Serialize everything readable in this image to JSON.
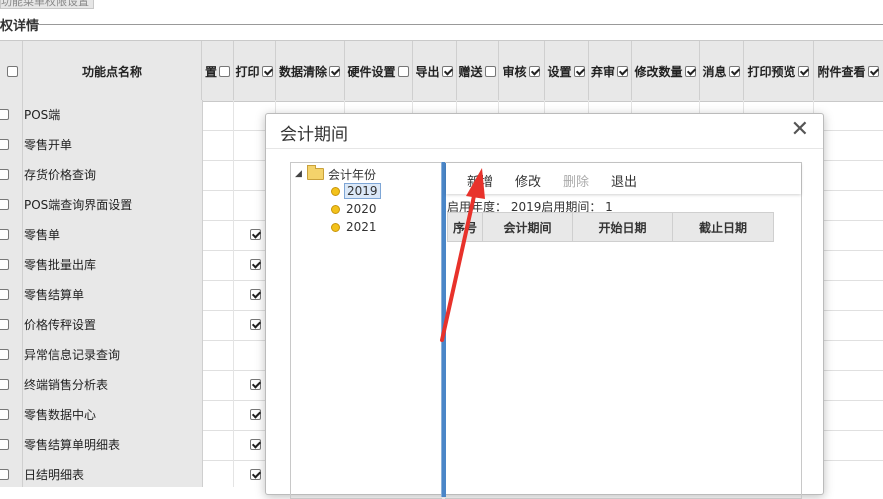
{
  "top_tab": "功能菜单权限设置",
  "section_title": "权详情",
  "grid": {
    "name_header": "功能点名称",
    "columns": [
      {
        "label": "置",
        "checked": false
      },
      {
        "label": "打印",
        "checked": true
      },
      {
        "label": "数据清除",
        "checked": true
      },
      {
        "label": "硬件设置",
        "checked": false
      },
      {
        "label": "导出",
        "checked": true
      },
      {
        "label": "赠送",
        "checked": false
      },
      {
        "label": "审核",
        "checked": true
      },
      {
        "label": "设置",
        "checked": true
      },
      {
        "label": "弃审",
        "checked": true
      },
      {
        "label": "修改数量",
        "checked": true
      },
      {
        "label": "消息",
        "checked": true
      },
      {
        "label": "打印预览",
        "checked": true
      },
      {
        "label": "附件查看",
        "checked": true
      }
    ],
    "rows": [
      {
        "name": "POS端",
        "print_checked": false
      },
      {
        "name": "零售开单",
        "print_checked": false
      },
      {
        "name": "存货价格查询",
        "print_checked": false
      },
      {
        "name": "POS端查询界面设置",
        "print_checked": false
      },
      {
        "name": "零售单",
        "print_checked": true
      },
      {
        "name": "零售批量出库",
        "print_checked": true
      },
      {
        "name": "零售结算单",
        "print_checked": true
      },
      {
        "name": "价格传秤设置",
        "print_checked": true
      },
      {
        "name": "异常信息记录查询",
        "print_checked": false
      },
      {
        "name": "终端销售分析表",
        "print_checked": true
      },
      {
        "name": "零售数据中心",
        "print_checked": true
      },
      {
        "name": "零售结算单明细表",
        "print_checked": true
      },
      {
        "name": "日结明细表",
        "print_checked": true
      }
    ]
  },
  "modal": {
    "title": "会计期间",
    "close_symbol": "✕",
    "tree": {
      "root_label": "会计年份",
      "years": [
        "2019",
        "2020",
        "2021"
      ],
      "selected": "2019"
    },
    "toolbar": {
      "add_label": "新增",
      "edit_label": "修改",
      "delete_label": "删除",
      "exit_label": "退出"
    },
    "info_text": "启用年度： 2019启用期间： 1",
    "table_headers": [
      "序号",
      "会计期间",
      "开始日期",
      "截止日期"
    ]
  },
  "annotation": {
    "color": "#e8322b"
  }
}
